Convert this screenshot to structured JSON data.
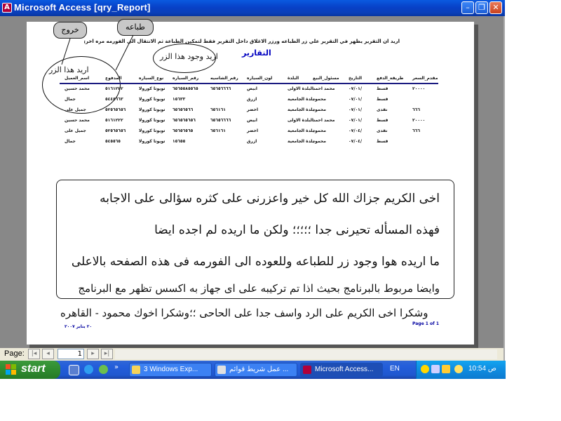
{
  "window": {
    "title": "Microsoft Access   [qry_Report]",
    "app_icon_letter": "A"
  },
  "report": {
    "top_sentence": "اريد ان التقرير يظهر في التقرير علي زر الطباعه ورزر الاغلاق داخل التقرير فقط لتمكين الطباعة ثم الانتقال الى الفورمه مره اخري",
    "title": "التقارير",
    "exit_button": "خروج",
    "print_button": "طباعه",
    "annotation_buttons": "اريد هذا الزر",
    "annotation_here": "اريد وجود هذا الزر",
    "columns": [
      "مقدم_السعر",
      "طريقة_الدفع",
      "التاريخ",
      "مسئول_البيع",
      "البلدة",
      "لون_السياره",
      "رقم_الشاسيه",
      "رقم_السياره",
      "نوع_السياره",
      "المدفوع",
      "اسم_العميل"
    ],
    "rows": [
      [
        "٢٠٠٠٠",
        "قسط",
        "٠٧/٠١/",
        "محمد احمد",
        "البلدة الاولى",
        "ابيض",
        "٦٥٦٥٦٦٦٦",
        "٦٥٦٥٥٨٥٥٦٥",
        "تويوتا كورولا",
        "٥١٦١٢٢٢",
        "محمد حسين"
      ],
      [
        "",
        "قسط",
        "٠٧/٠١/",
        "محمود",
        "بلدة الجامعية",
        "ازرق",
        "",
        "١٥٦٣٣",
        "تويوتا كورولا",
        "٥٤٤٥٦٦٣",
        "جمال"
      ],
      [
        "٦٦٦",
        "نقدى",
        "٠٧/٠١/",
        "محمود",
        "بلدة الجامعية",
        "اخضر",
        "٦٥٦١٦١",
        "٦٥٦٥٦٥٦٦",
        "تويوتا كورولا",
        "٥٢٥٦٥٦٥٦",
        "جميل على"
      ],
      [
        "٢٠٠٠٠",
        "قسط",
        "٠٧/٠١/",
        "محمد احمد",
        "البلدة الاولى",
        "ابيض",
        "٦٥٦٥٦٦٦٦",
        "٦٥٦٥٦٥٦٥٦",
        "تويوتا كورولا",
        "٥١٦١٢٢٢",
        "محمد حسين"
      ],
      [
        "٦٦٦",
        "نقدى",
        "٠٧/٠٤/",
        "محمود",
        "بلدة الجامعية",
        "اخضر",
        "٦٥٦١٦١",
        "٦٥٦٥٦٥٦٥",
        "تويوتا كورولا",
        "٥٢٥٦٥٦٥٦",
        "جميل على"
      ],
      [
        "",
        "قسط",
        "٠٧/٠٤/",
        "محمود",
        "بلدة الجامعية",
        "ازرق",
        "",
        "١٥٦٥٥",
        "تويوتا كورولا",
        "٥٤٥٥٦٥",
        "جمال"
      ]
    ],
    "message_lines": [
      "اخى الكريم جزاك الله كل خير واعزرنى على كثره سؤالى على الاجابه",
      "فهذه المسأله تحيرنى جدا ؛؛؛؛؛ ولكن ما اريده لم اجده ايضا",
      "ما اريده هوا وجود زر للطباعه وللعوده الى الفورمه فى هذه الصفحه بالاعلى",
      "وايضا مربوط بالبرنامج بحيث اذا تم تركيبه على اى جهاز به اكسس تظهر مع البرنامج",
      "وشكرا اخى الكريم على الرد واسف جدا على الحاحى ؛؛وشكرا اخوك محمود - القاهره"
    ],
    "footer_left": "٢٠ يناير ٢٠٠٧",
    "footer_right": "Page 1 of 1"
  },
  "navigation": {
    "label": "Page:",
    "page_value": "1",
    "first": "|◂",
    "prev": "◂",
    "next": "▸",
    "last": "▸|"
  },
  "taskbar": {
    "start_label": "start",
    "tasks": [
      "3 Windows Exp...",
      "عمل شريط قوائم ...",
      "Microsoft Access..."
    ],
    "language": "EN",
    "clock": "10:54 ص"
  }
}
